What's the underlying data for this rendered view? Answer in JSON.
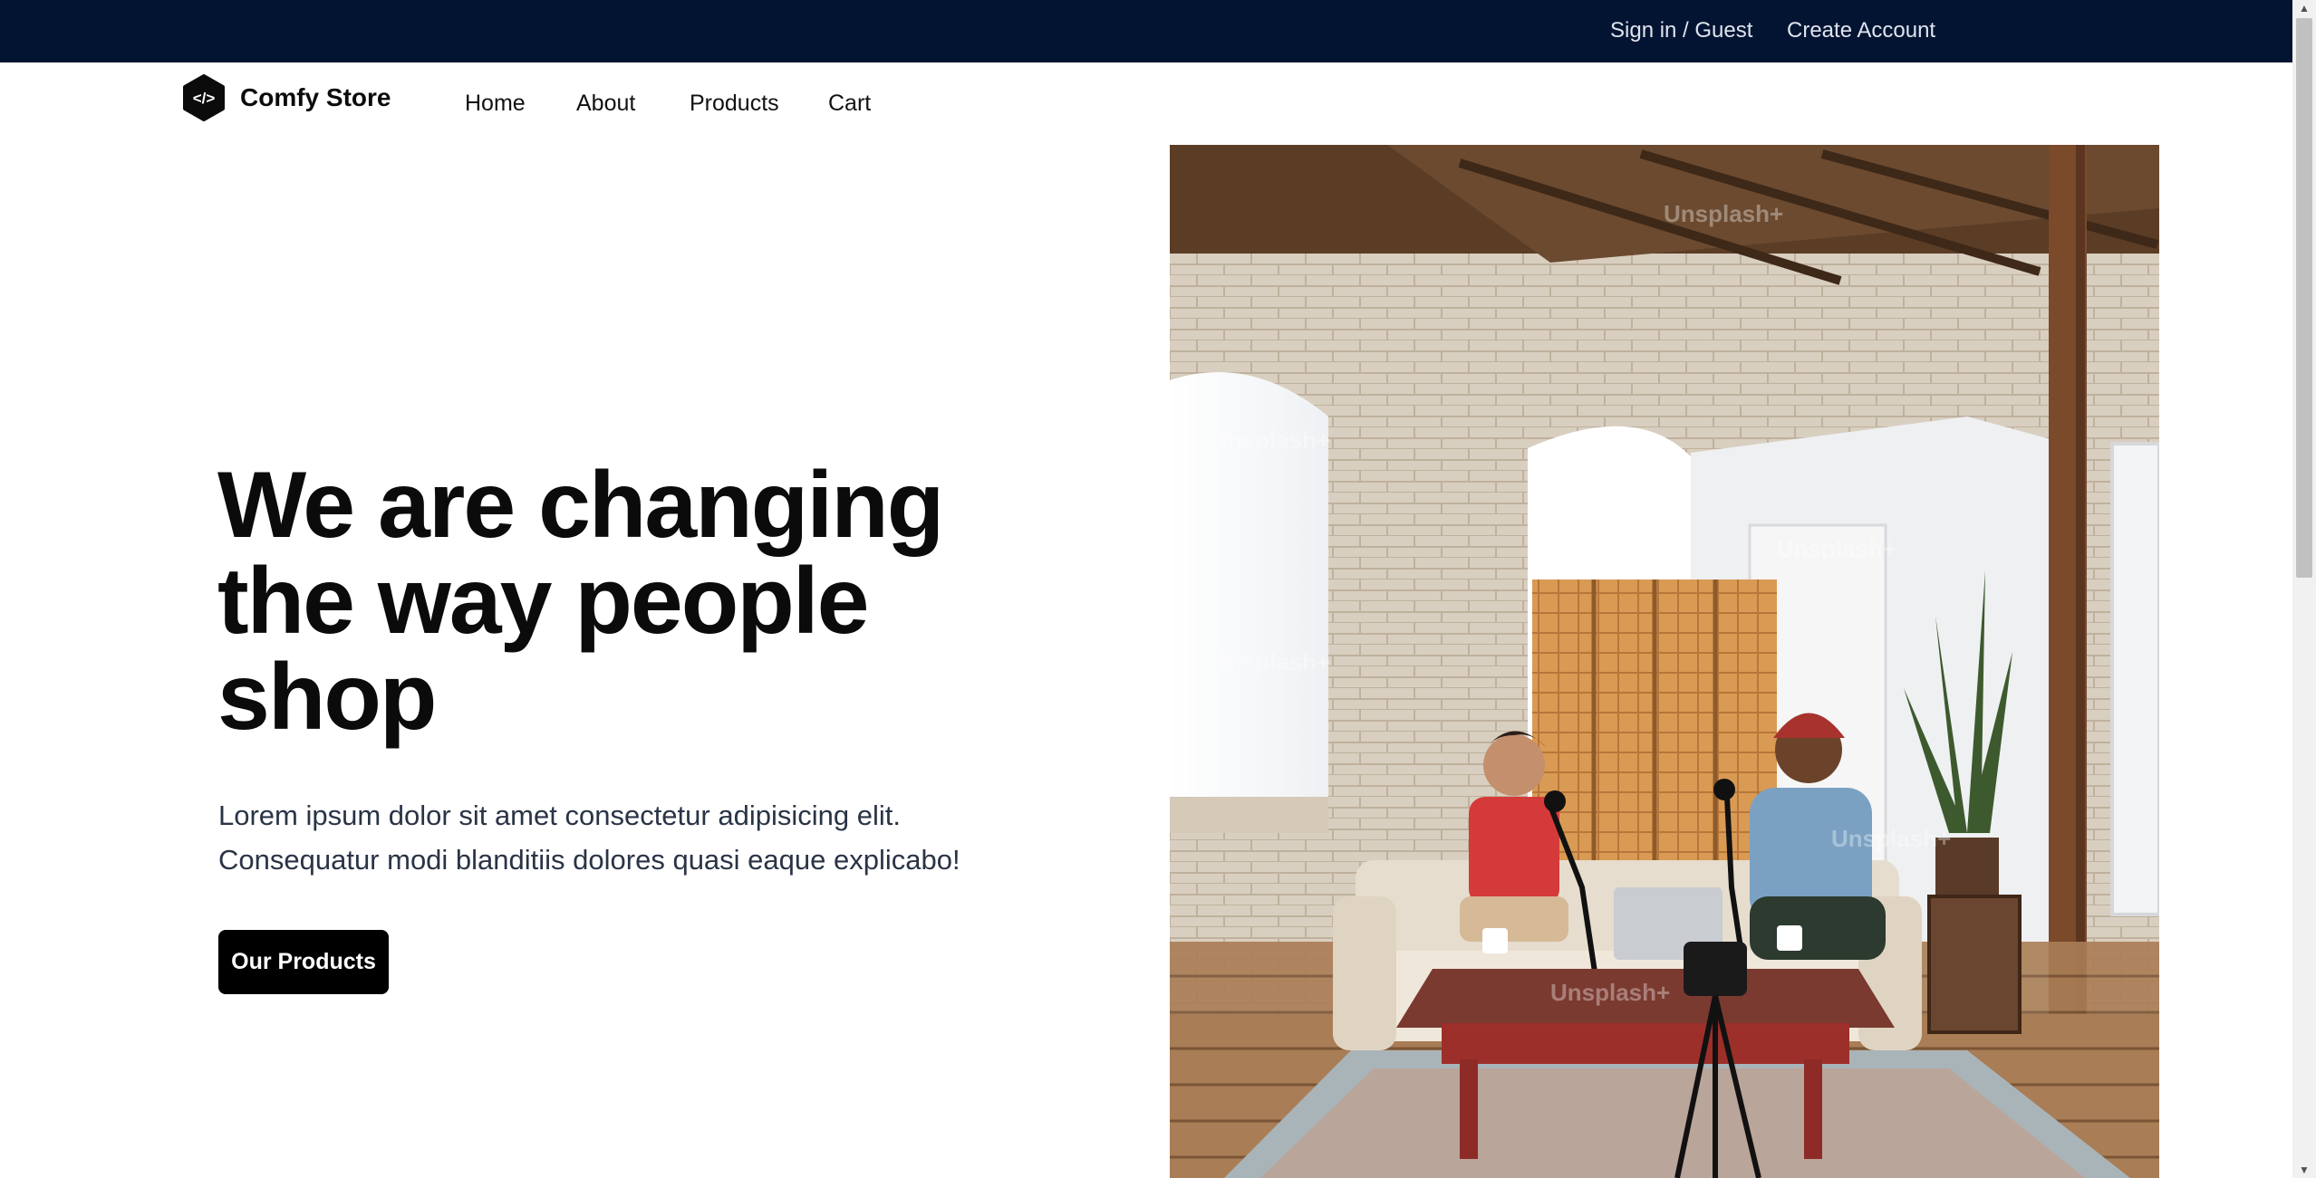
{
  "topbar": {
    "sign_in": "Sign in / Guest",
    "create_account": "Create Account",
    "background": "#021431"
  },
  "brand": {
    "logo_glyph": "</>",
    "name": "Comfy Store",
    "icon": "code-hexagon-icon"
  },
  "nav": {
    "items": [
      {
        "label": "Home"
      },
      {
        "label": "About"
      },
      {
        "label": "Products"
      },
      {
        "label": "Cart"
      }
    ]
  },
  "hero": {
    "headline_lines": [
      "We are changing",
      "the way people",
      "shop"
    ],
    "lede_lines": [
      "Lorem ipsum dolor sit amet consectetur adipisicing elit.",
      "Consequatur modi blanditiis dolores quasi eaque explicabo!"
    ],
    "cta_label": "Our Products",
    "image_watermark": "Unsplash+"
  },
  "colors": {
    "accent": "#000000",
    "text": "#0b0b0b",
    "muted_text": "#2a3446"
  }
}
